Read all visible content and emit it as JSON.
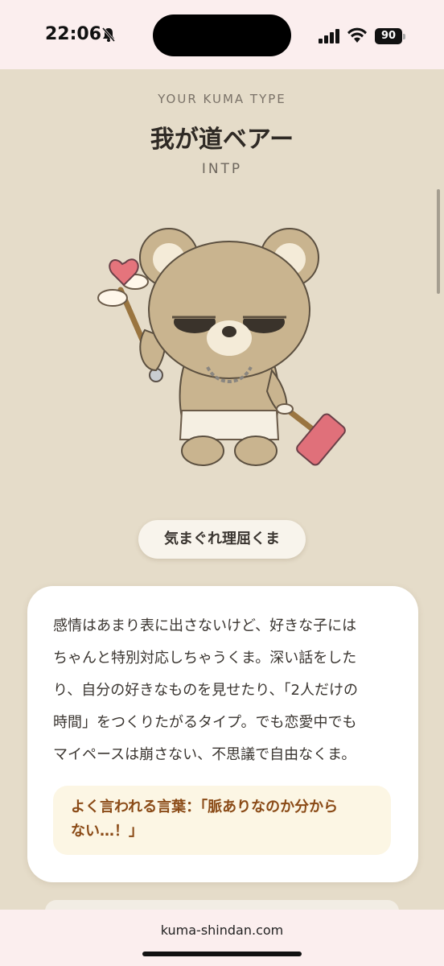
{
  "status_bar": {
    "time": "22:06",
    "battery": "90",
    "icons": [
      "bell-muted-icon",
      "signal-icon",
      "wifi-icon",
      "battery-icon"
    ]
  },
  "result": {
    "eyebrow": "YOUR KUMA TYPE",
    "title": "我が道ベアー",
    "mbti": "INTP",
    "nickname": "気まぐれ理屈くま"
  },
  "description": {
    "lines": [
      "感情はあまり表に出さないけど、好きな子には",
      "ちゃんと特別対応しちゃうくま。深い話をした",
      "り、自分の好きなものを見せたり、「2人だけの",
      "時間」をつくりたがるタイプ。でも恋愛中でも",
      "マイペースは崩さない、不思議で自由なくま。"
    ],
    "quote_lines": [
      "よく言われる言葉：「脈ありなのか分から",
      "ない…！」"
    ]
  },
  "browser": {
    "url": "kuma-shindan.com"
  },
  "colors": {
    "background": "#e5dcc9",
    "card": "#ffffff",
    "quote_bg": "#fcf6e4",
    "quote_text": "#8a4a16",
    "status_bar_bg": "#fbeeee"
  }
}
